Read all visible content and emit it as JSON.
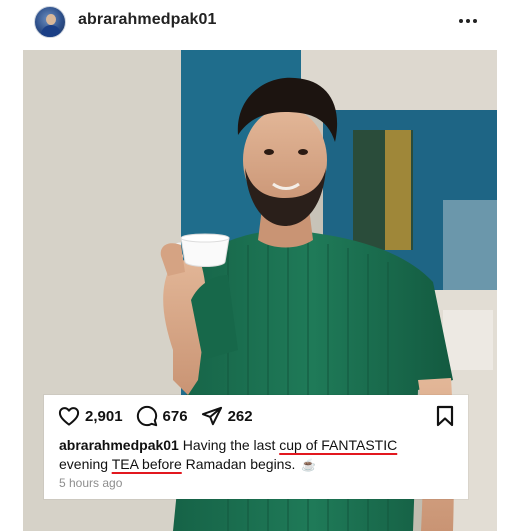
{
  "post": {
    "username": "abrarahmedpak01",
    "more_label": "More options"
  },
  "actions": {
    "likes": "2,901",
    "comments": "676",
    "shares": "262"
  },
  "caption": {
    "user": "abrarahmedpak01",
    "text_1": " Having the last ",
    "text_2": "cup of FANTASTIC",
    "text_3": "evening ",
    "text_4": "TEA before",
    "text_5": " Ramadan begins. ",
    "emoji": "☕"
  },
  "timestamp": "5 hours ago",
  "colors": {
    "underline": "#e2181f",
    "shirt": "#1d6b4f",
    "wall_teal": "#1f6d8c",
    "text_muted": "#8e8e8e"
  },
  "icons": [
    "heart-icon",
    "comment-icon",
    "share-icon",
    "bookmark-icon",
    "more-icon"
  ]
}
